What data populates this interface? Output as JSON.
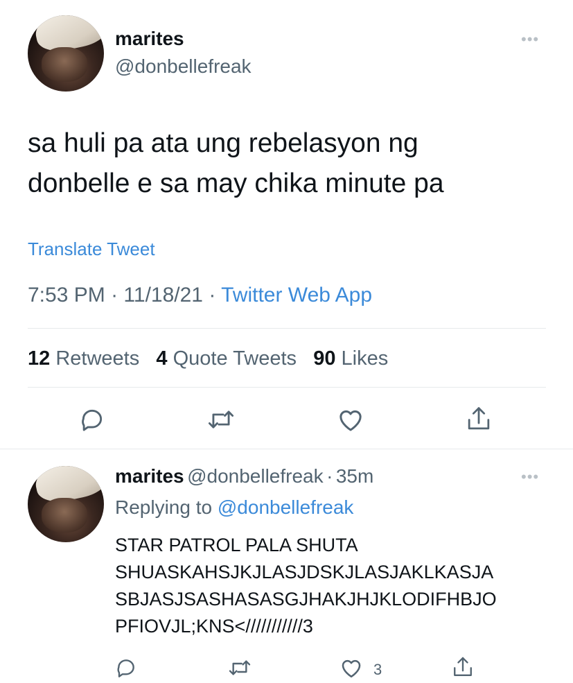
{
  "main_tweet": {
    "display_name": "marites",
    "handle": "@donbellefreak",
    "more_label": "•••",
    "text_lines": [
      "sa huli pa ata ung rebelasyon ng",
      "donbelle e sa may chika minute pa"
    ],
    "translate_label": "Translate Tweet",
    "time": "7:53 PM",
    "date": "11/18/21",
    "sep": "·",
    "source": "Twitter Web App",
    "stats": {
      "retweets_count": "12",
      "retweets_label": "Retweets",
      "quotes_count": "4",
      "quotes_label": "Quote Tweets",
      "likes_count": "90",
      "likes_label": "Likes"
    },
    "actions": [
      "reply-icon",
      "retweet-icon",
      "like-icon",
      "share-icon"
    ]
  },
  "reply_tweet": {
    "display_name": "marites",
    "handle": "@donbellefreak",
    "sep": "·",
    "age": "35m",
    "more_label": "•••",
    "replying_prefix": "Replying to",
    "replying_to": "@donbellefreak",
    "text_lines": [
      "STAR PATROL PALA SHUTA",
      "SHUASKAHSJKJLASJDSKJLASJAKLKASJA",
      "SBJASJSASHASASGJHAKJHJKLODIFHBJO",
      "PFIOVJL;KNS<///////////3"
    ],
    "like_count": "3",
    "actions": [
      "reply-icon",
      "retweet-icon",
      "like-icon",
      "share-icon"
    ]
  },
  "colors": {
    "link": "#3b8ad9",
    "muted": "#536471",
    "text": "#0f1419",
    "divider": "#e6e9eb"
  }
}
